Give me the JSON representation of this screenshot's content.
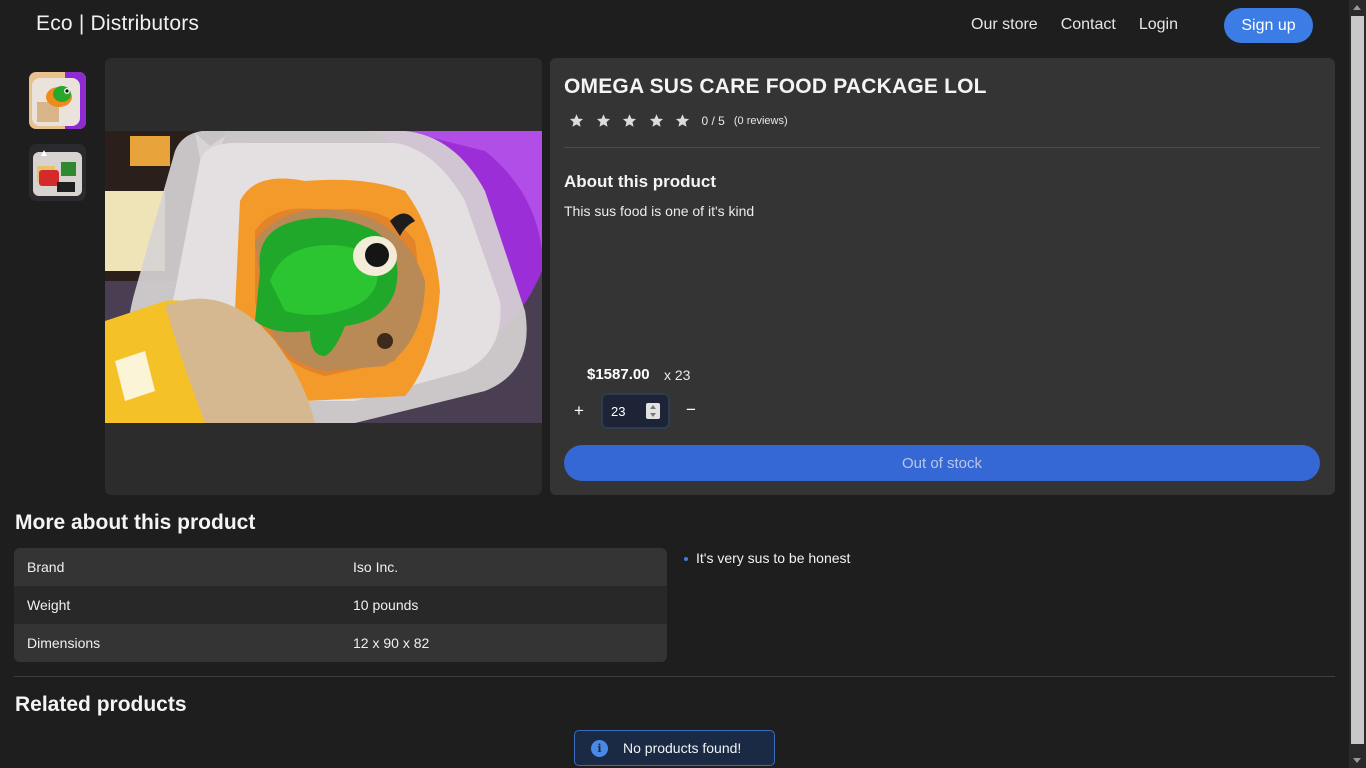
{
  "header": {
    "brand": "Eco | Distributors",
    "nav": [
      "Our store",
      "Contact",
      "Login"
    ],
    "signup_label": "Sign up"
  },
  "product": {
    "title": "OMEGA SUS CARE FOOD PACKAGE LOL",
    "rating": {
      "stars_filled": 0,
      "stars_total": 5,
      "score_text": "0 / 5",
      "reviews_text": "(0 reviews)"
    },
    "about_heading": "About this product",
    "about_text": "This sus food is one of it's kind",
    "price": "$1587.00",
    "price_qty": "x 23",
    "quantity": "23",
    "plus_label": "+",
    "minus_label": "−",
    "stock_button_label": "Out of stock"
  },
  "more": {
    "heading": "More about this product",
    "specs": [
      {
        "key": "Brand",
        "value": "Iso Inc."
      },
      {
        "key": "Weight",
        "value": "10 pounds"
      },
      {
        "key": "Dimensions",
        "value": "12 x 90 x 82"
      }
    ],
    "features": [
      "It's very sus to be honest"
    ]
  },
  "related": {
    "heading": "Related products",
    "empty_message": "No products found!"
  },
  "colors": {
    "accent": "#3b7de4",
    "background": "#1e1e1e",
    "panel": "#343434"
  }
}
